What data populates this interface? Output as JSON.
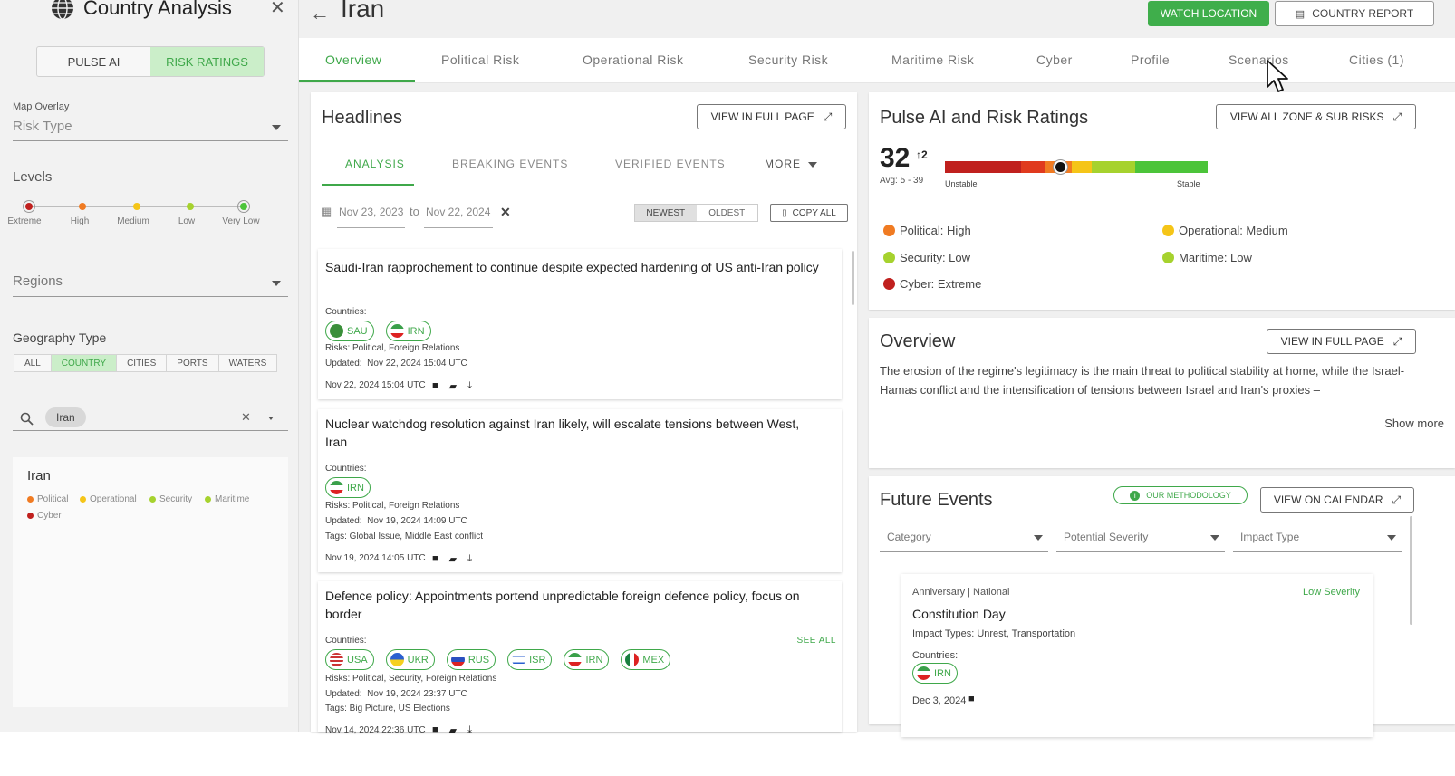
{
  "sidebar": {
    "title": "Country Analysis",
    "mode_tabs": [
      "PULSE AI",
      "RISK RATINGS"
    ],
    "map_overlay": {
      "label": "Map Overlay",
      "value": "Risk Type"
    },
    "levels": {
      "title": "Levels",
      "items": [
        {
          "label": "Extreme",
          "color": "#c0201e"
        },
        {
          "label": "High",
          "color": "#f07b22"
        },
        {
          "label": "Medium",
          "color": "#f5c518"
        },
        {
          "label": "Low",
          "color": "#a6d22e"
        },
        {
          "label": "Very Low",
          "color": "#4cc43a"
        }
      ]
    },
    "regions": {
      "value": "Regions"
    },
    "geography": {
      "title": "Geography Type",
      "options": [
        "ALL",
        "COUNTRY",
        "CITIES",
        "PORTS",
        "WATERS"
      ],
      "selected": "COUNTRY"
    },
    "search": {
      "chip": "Iran"
    },
    "country_card": {
      "name": "Iran",
      "legend": [
        {
          "label": "Political",
          "color": "#f07b22"
        },
        {
          "label": "Operational",
          "color": "#f5c518"
        },
        {
          "label": "Security",
          "color": "#a6d22e"
        },
        {
          "label": "Maritime",
          "color": "#a6d22e"
        },
        {
          "label": "Cyber",
          "color": "#c0201e"
        }
      ]
    }
  },
  "header": {
    "title": "Iran",
    "watch_button": "WATCH LOCATION",
    "report_button": "COUNTRY REPORT"
  },
  "tabs": [
    "Overview",
    "Political Risk",
    "Operational Risk",
    "Security Risk",
    "Maritime Risk",
    "Cyber",
    "Profile",
    "Scenarios",
    "Cities (1)"
  ],
  "headlines": {
    "title": "Headlines",
    "full_page": "VIEW IN FULL PAGE",
    "subtabs": [
      "ANALYSIS",
      "BREAKING EVENTS",
      "VERIFIED EVENTS",
      "MORE"
    ],
    "date_from": "Nov 23, 2023",
    "date_to_word": "to",
    "date_to": "Nov 22, 2024",
    "sort": [
      "NEWEST",
      "OLDEST"
    ],
    "copy_all": "COPY ALL",
    "countries_label": "Countries:",
    "see_all": "SEE ALL",
    "articles": [
      {
        "title": "Saudi-Iran rapprochement to continue despite expected hardening of US anti-Iran policy",
        "countries": [
          "SAU",
          "IRN"
        ],
        "risks": "Risks: Political, Foreign Relations",
        "updated_label": "Updated:",
        "updated": "Nov 22, 2024 15:04 UTC",
        "footer_date": "Nov 22, 2024 15:04 UTC"
      },
      {
        "title": "Nuclear watchdog resolution against Iran likely, will escalate tensions between West, Iran",
        "countries": [
          "IRN"
        ],
        "risks": "Risks: Political, Foreign Relations",
        "updated_label": "Updated:",
        "updated": "Nov 19, 2024 14:09 UTC",
        "tags": "Tags: Global Issue, Middle East conflict",
        "footer_date": "Nov 19, 2024 14:05 UTC"
      },
      {
        "title": "Defence policy: Appointments portend unpredictable foreign defence policy, focus on border",
        "countries": [
          "USA",
          "UKR",
          "RUS",
          "ISR",
          "IRN",
          "MEX"
        ],
        "risks": "Risks: Political, Security, Foreign Relations",
        "updated_label": "Updated:",
        "updated": "Nov 19, 2024 23:37 UTC",
        "tags": "Tags: Big Picture, US Elections",
        "footer_date": "Nov 14, 2024 22:36 UTC"
      }
    ]
  },
  "pulse": {
    "title": "Pulse AI and Risk Ratings",
    "view_all": "VIEW ALL ZONE & SUB RISKS",
    "score": "32",
    "delta": "2",
    "avg": "Avg: 5 - 39",
    "unstable": "Unstable",
    "stable": "Stable",
    "score_position": 0.44,
    "ratings": [
      {
        "label": "Political: High",
        "color": "#f07b22"
      },
      {
        "label": "Operational: Medium",
        "color": "#f5c518"
      },
      {
        "label": "Security: Low",
        "color": "#a6d22e"
      },
      {
        "label": "Maritime: Low",
        "color": "#a6d22e"
      },
      {
        "label": "Cyber: Extreme",
        "color": "#c0201e"
      }
    ]
  },
  "overview": {
    "title": "Overview",
    "full_page": "VIEW IN FULL PAGE",
    "text": "The erosion of the regime's legitimacy is the main threat to political stability at home, while the Israel-Hamas conflict and the intensification of tensions between Israel and Iran's proxies –",
    "show_more": "Show more"
  },
  "future_events": {
    "title": "Future Events",
    "methodology": "OUR METHODOLOGY",
    "calendar": "VIEW ON CALENDAR",
    "filters": [
      "Category",
      "Potential Severity",
      "Impact Type"
    ],
    "event": {
      "kind": "Anniversary | National",
      "severity": "Low Severity",
      "name": "Constitution Day",
      "impact": "Impact Types: Unrest, Transportation",
      "countries_label": "Countries:",
      "country": "IRN",
      "date": "Dec 3, 2024"
    }
  },
  "colors": {
    "accent": "#3fa84a",
    "watch_button": "#3fae4b"
  }
}
